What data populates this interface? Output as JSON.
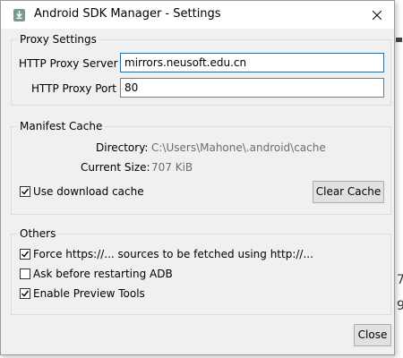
{
  "window": {
    "title": "Android SDK Manager - Settings"
  },
  "proxy": {
    "legend": "Proxy Settings",
    "server_label": "HTTP Proxy Server",
    "server_value": "mirrors.neusoft.edu.cn",
    "port_label": "HTTP Proxy Port",
    "port_value": "80"
  },
  "manifest": {
    "legend": "Manifest Cache",
    "directory_label": "Directory:",
    "directory_value": "C:\\Users\\Mahone\\.android\\cache",
    "size_label": "Current Size:",
    "size_value": "707 KiB",
    "use_cache_label": "Use download cache",
    "use_cache_checked": true,
    "clear_button": "Clear Cache"
  },
  "others": {
    "legend": "Others",
    "items": [
      {
        "label": "Force https://... sources to be fetched using http://...",
        "checked": true
      },
      {
        "label": "Ask before restarting ADB",
        "checked": false
      },
      {
        "label": "Enable Preview Tools",
        "checked": true
      }
    ]
  },
  "footer": {
    "close_button": "Close"
  },
  "background_fragments": [
    "7",
    "9"
  ]
}
